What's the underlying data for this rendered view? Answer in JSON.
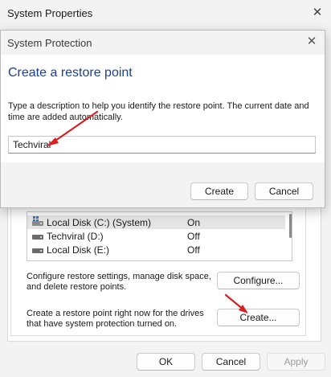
{
  "system_properties": {
    "title": "System Properties",
    "close_glyph": "✕",
    "drives": [
      {
        "name": "Local Disk (C:) (System)",
        "protection": "On",
        "icon": "windows-drive-icon"
      },
      {
        "name": "Techviral (D:)",
        "protection": "Off",
        "icon": "drive-icon"
      },
      {
        "name": "Local Disk (E:)",
        "protection": "Off",
        "icon": "drive-icon"
      }
    ],
    "configure_text": "Configure restore settings, manage disk space, and delete restore points.",
    "configure_button": "Configure...",
    "create_text": "Create a restore point right now for the drives that have system protection turned on.",
    "create_button": "Create...",
    "ok_button": "OK",
    "cancel_button": "Cancel",
    "apply_button": "Apply"
  },
  "system_protection_dialog": {
    "title": "System Protection",
    "close_glyph": "✕",
    "heading": "Create a restore point",
    "instructions": "Type a description to help you identify the restore point. The current date and time are added automatically.",
    "input_value": "Techviral",
    "create_button": "Create",
    "cancel_button": "Cancel"
  },
  "colors": {
    "heading": "#1e3f8a",
    "annotation_arrow": "#d9201f"
  }
}
